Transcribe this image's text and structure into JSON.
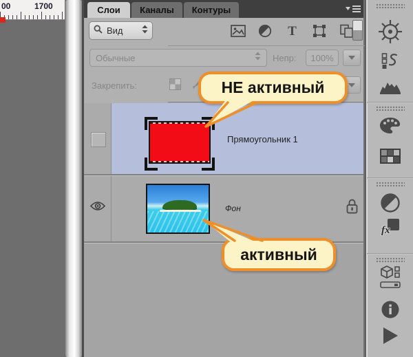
{
  "ruler": {
    "labels": [
      "00",
      "1700"
    ]
  },
  "panel": {
    "tabs": [
      {
        "label": "Слои",
        "active": true
      },
      {
        "label": "Каналы",
        "active": false
      },
      {
        "label": "Контуры",
        "active": false
      }
    ],
    "filter": {
      "kind_label": "Вид",
      "type_letter": "T",
      "type_icons": [
        "pixel-layers",
        "adjustment-layers",
        "type-layers",
        "shape-layers",
        "smart-objects"
      ]
    },
    "blend": {
      "mode": "Обычные",
      "opacity_label": "Непр:",
      "opacity_value": "100%"
    },
    "lock": {
      "label": "Закрепить:",
      "icons": [
        "lock-transparency",
        "lock-paint"
      ]
    },
    "layers": [
      {
        "name": "Прямоугольник 1",
        "selected": true,
        "visible": false,
        "thumbnail": "red-rectangle",
        "locked": false
      },
      {
        "name": "Фон",
        "selected": false,
        "visible": true,
        "thumbnail": "tropical-island-photo",
        "locked": true
      }
    ]
  },
  "callouts": [
    {
      "text": "НЕ активный"
    },
    {
      "text": "активный"
    }
  ],
  "dock": {
    "styles_label": "fx",
    "icons": [
      "navigator-wheel",
      "history",
      "histogram",
      "color-palette",
      "swatches",
      "adjustments",
      "styles-fx",
      "3d",
      "timeline",
      "info",
      "actions-play"
    ]
  },
  "colors": {
    "selection_blue": "#b5bedb",
    "panel_gray": "#b1b1b1",
    "tab_bar": "#3f3f3f",
    "callout_fill": "#fcf4c6",
    "callout_border": "#ef8f2a",
    "layer_thumb_red": "#f20d16"
  }
}
